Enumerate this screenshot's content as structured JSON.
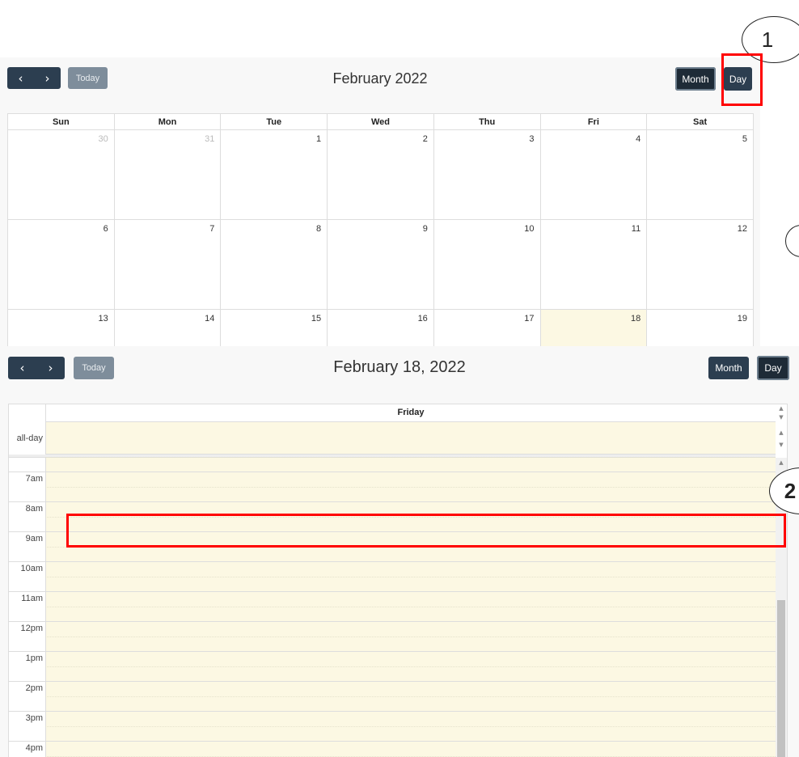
{
  "month_view": {
    "nav": {
      "prev_icon": "‹",
      "next_icon": "›"
    },
    "today_label": "Today",
    "title": "February 2022",
    "month_label": "Month",
    "day_label": "Day",
    "weekdays": [
      "Sun",
      "Mon",
      "Tue",
      "Wed",
      "Thu",
      "Fri",
      "Sat"
    ],
    "weeks": [
      [
        "30",
        "31",
        "1",
        "2",
        "3",
        "4",
        "5"
      ],
      [
        "6",
        "7",
        "8",
        "9",
        "10",
        "11",
        "12"
      ],
      [
        "13",
        "14",
        "15",
        "16",
        "17",
        "18",
        "19"
      ]
    ],
    "today_date": "18"
  },
  "day_view": {
    "nav": {
      "prev_icon": "‹",
      "next_icon": "›"
    },
    "today_label": "Today",
    "title": "February 18, 2022",
    "month_label": "Month",
    "day_label": "Day",
    "column_header": "Friday",
    "allday_label": "all-day",
    "time_labels": [
      "7am",
      "8am",
      "9am",
      "10am",
      "11am",
      "12pm",
      "1pm",
      "2pm",
      "3pm",
      "4pm"
    ]
  },
  "annotations": {
    "callout_1": "1",
    "callout_2": "2"
  },
  "colors": {
    "accent": "#2c3e50",
    "today_bg": "#fcf8e3",
    "highlight": "#ff0000"
  }
}
